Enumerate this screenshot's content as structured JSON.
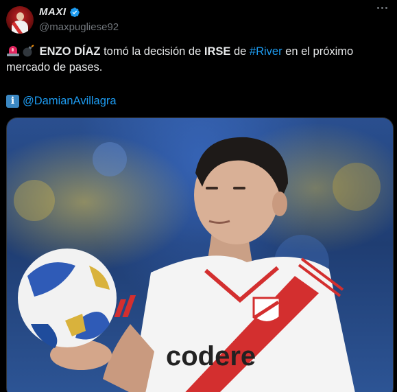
{
  "author": {
    "display_name": "MAXI",
    "handle": "@maxpugliese92",
    "verified": true,
    "avatar": "avatar-player-icon"
  },
  "tweet": {
    "emojis": [
      "siren-emoji",
      "bomb-emoji"
    ],
    "segments": [
      {
        "text": "ENZO DÍAZ",
        "style": "bold"
      },
      {
        "text": " tomó la decisión de ",
        "style": "normal"
      },
      {
        "text": "IRSE",
        "style": "bold"
      },
      {
        "text": " de ",
        "style": "normal"
      },
      {
        "text": "#River",
        "style": "link"
      },
      {
        "text": " en el próximo mercado de pases.",
        "style": "normal"
      }
    ],
    "credit_icon": "information-icon",
    "credit_mention": "@DamianAvillagra"
  },
  "media": {
    "jersey_sponsor": "codere",
    "description_icon": "photo"
  },
  "colors": {
    "background": "#000000",
    "text": "#e7e9ea",
    "secondary": "#71767b",
    "link": "#1d9bf0",
    "verified": "#1d9bf0"
  }
}
